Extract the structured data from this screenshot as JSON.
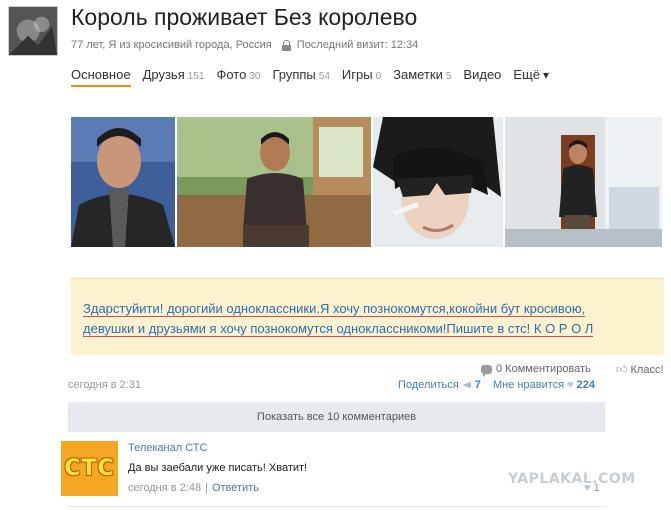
{
  "profile": {
    "name": "Король проживает Без королево",
    "info": "77 лет, Я из кросисивий города, Россия",
    "last_visit": "Последний визит: 12:34"
  },
  "nav": {
    "items": [
      {
        "label": "Основное",
        "count": ""
      },
      {
        "label": "Друзья",
        "count": "151"
      },
      {
        "label": "Фото",
        "count": "30"
      },
      {
        "label": "Группы",
        "count": "54"
      },
      {
        "label": "Игры",
        "count": "0"
      },
      {
        "label": "Заметки",
        "count": "5"
      },
      {
        "label": "Видео",
        "count": ""
      },
      {
        "label": "Ещё",
        "count": ""
      }
    ]
  },
  "post": {
    "text_line1": "Здарстуйити! дорогийи одноклассники.Я хочу познокомутся,кокойни бут кросивою,",
    "text_line2": "девушки и друзьями я хочу познокомутся одноклассникоми!Пишите в стс! К О Р О Л",
    "comments": "0 Комментировать",
    "klass": "Класс!",
    "timestamp": "сегодня в 2:31",
    "share_label": "Поделиться",
    "share_count": "7",
    "likes_label": "Мне нравится",
    "likes_count": "224"
  },
  "show_all": "Показать все 10 комментариев",
  "comment": {
    "avatar_logo": "СТС",
    "author": "Телеканал СТС",
    "text": "Да вы заебали уже писать! Хватит!",
    "time": "сегодня в 2:48",
    "separator": "|",
    "reply": "Ответить",
    "likes": "1"
  },
  "watermark": "YAPLAKAL.COM",
  "colors": {
    "accent": "#f59100",
    "link": "#4a7bb0",
    "post_bg": "#fdf2d0"
  }
}
